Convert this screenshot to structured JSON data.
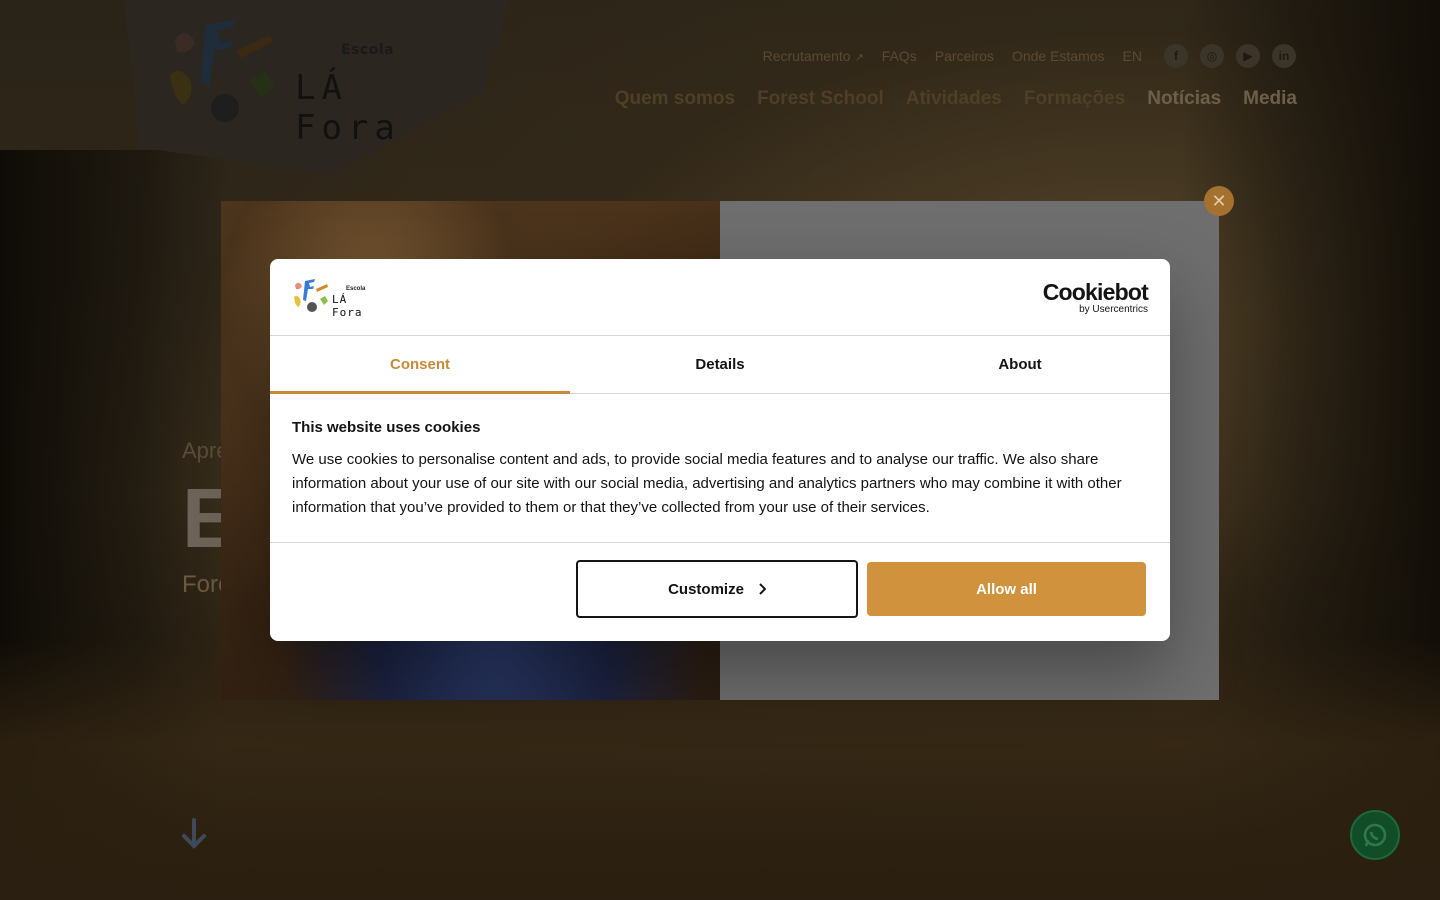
{
  "site": {
    "logo": {
      "escola": "Escola",
      "lafora": "LÁ Fora"
    },
    "top_links": [
      {
        "label": "Recrutamento"
      },
      {
        "label": "FAQs"
      },
      {
        "label": "Parceiros"
      },
      {
        "label": "Onde Estamos"
      },
      {
        "label": "EN"
      }
    ],
    "socials": [
      "facebook-icon",
      "instagram-icon",
      "youtube-icon",
      "linkedin-icon"
    ],
    "nav": [
      "Quem somos",
      "Forest School",
      "Atividades",
      "Formações",
      "Notícias",
      "Media"
    ],
    "hero": {
      "sub": "Apre",
      "big": "E",
      "forest": "Fore"
    }
  },
  "cookie": {
    "brand": {
      "name": "Cookiebot",
      "by": "by Usercentrics"
    },
    "logo": {
      "escola": "Escola",
      "lafora": "LÁ Fora"
    },
    "tabs": [
      "Consent",
      "Details",
      "About"
    ],
    "title": "This website uses cookies",
    "text": "We use cookies to personalise content and ads, to provide social media features and to analyse our traffic. We also share information about your use of our site with our social media, advertising and analytics partners who may combine it with other information that you’ve provided to them or that they’ve collected from your use of their services.",
    "customize_label": "Customize",
    "allow_label": "Allow all"
  },
  "colors": {
    "accent": "#d0923d",
    "tab_active": "#c8893a"
  }
}
